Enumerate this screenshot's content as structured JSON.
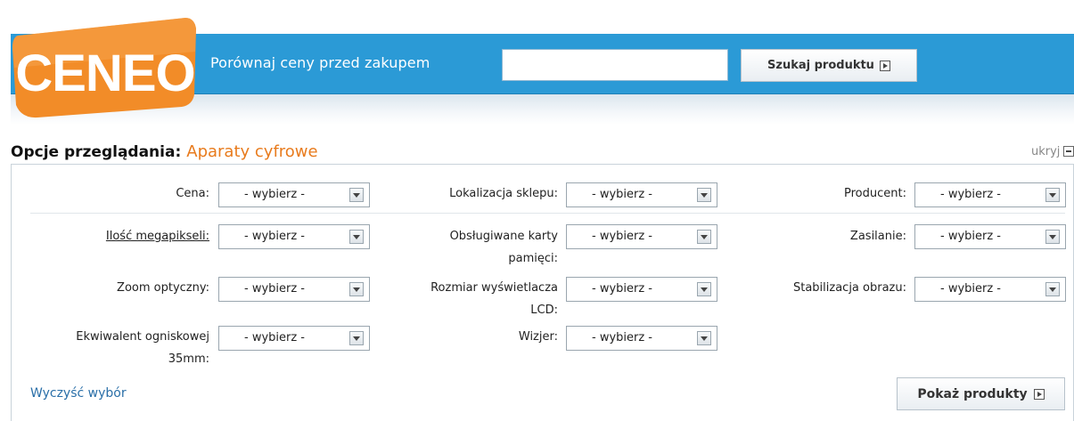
{
  "header": {
    "logo_text": "CENEO",
    "tagline": "Porównaj ceny przed zakupem",
    "search_value": "",
    "search_button": "Szukaj produktu",
    "accent_color": "#2b9ad6",
    "logo_color": "#f28c28"
  },
  "options": {
    "title": "Opcje przeglądania:",
    "category": "Aparaty cyfrowe",
    "hide_label": "ukryj"
  },
  "filters": {
    "cena": {
      "label": "Cena:",
      "value": "- wybierz -"
    },
    "lokalizacja": {
      "label": "Lokalizacja sklepu:",
      "value": "- wybierz -"
    },
    "producent": {
      "label": "Producent:",
      "value": "- wybierz -"
    },
    "megapiksele": {
      "label": "Ilość megapikseli:",
      "value": "- wybierz -"
    },
    "karty_l1": "Obsługiwane karty",
    "karty_l2": "pamięci:",
    "karty_value": "- wybierz -",
    "zasilanie": {
      "label": "Zasilanie:",
      "value": "- wybierz -"
    },
    "zoom": {
      "label": "Zoom optyczny:",
      "value": "- wybierz -"
    },
    "lcd_l1": "Rozmiar wyświetlacza",
    "lcd_l2": "LCD:",
    "lcd_value": "- wybierz -",
    "stabilizacja": {
      "label": "Stabilizacja obrazu:",
      "value": "- wybierz -"
    },
    "ekw_l1": "Ekwiwalent ogniskowej",
    "ekw_l2": "35mm:",
    "ekw_value": "- wybierz -",
    "wizjer": {
      "label": "Wizjer:",
      "value": "- wybierz -"
    }
  },
  "footer": {
    "clear_link": "Wyczyść wybór",
    "show_button": "Pokaż produkty"
  }
}
